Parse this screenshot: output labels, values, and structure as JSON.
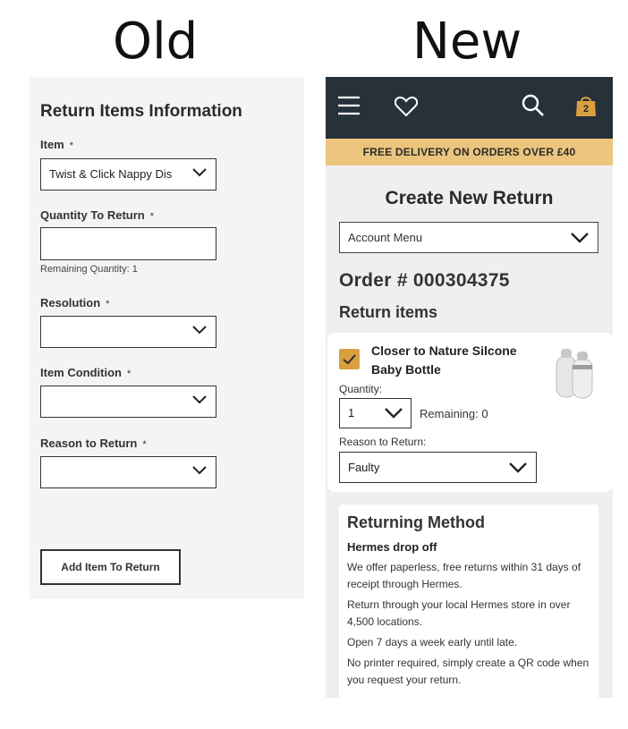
{
  "headings": {
    "old": "Old",
    "new": "New"
  },
  "old": {
    "title": "Return Items Information",
    "fields": {
      "item_label": "Item",
      "item_value": "Twist & Click Nappy Dis",
      "quantity_label": "Quantity To Return",
      "quantity_value": "",
      "remaining": "Remaining Quantity: 1",
      "resolution_label": "Resolution",
      "resolution_value": "",
      "condition_label": "Item Condition",
      "condition_value": "",
      "reason_label": "Reason to Return",
      "reason_value": ""
    },
    "required_mark": "*",
    "add_button": "Add Item To Return"
  },
  "new": {
    "topbar": {
      "background": "#27313a",
      "icons": [
        "menu-icon",
        "heart-icon",
        "search-icon",
        "bag-icon"
      ],
      "cart_count": "2"
    },
    "promo": "FREE DELIVERY ON ORDERS OVER £40",
    "title": "Create New Return",
    "account_menu": "Account Menu",
    "order": "Order # 000304375",
    "return_items": "Return items",
    "item": {
      "name": "Closer to Nature Silcone Baby Bottle",
      "quantity_label": "Quantity:",
      "quantity_value": "1",
      "remaining": "Remaining: 0",
      "reason_label": "Reason to Return:",
      "reason_value": "Faulty"
    },
    "method": {
      "title": "Returning Method",
      "subtitle": "Hermes drop off",
      "paragraphs": [
        "We offer paperless, free returns within 31 days of receipt through Hermes.",
        "Return through your local Hermes store in over 4,500 locations.",
        "Open 7 days a week early until late.",
        "No printer required, simply create a QR code when you request your return."
      ]
    },
    "accent": "#d9a040",
    "promo_color": "#ebc57d"
  }
}
